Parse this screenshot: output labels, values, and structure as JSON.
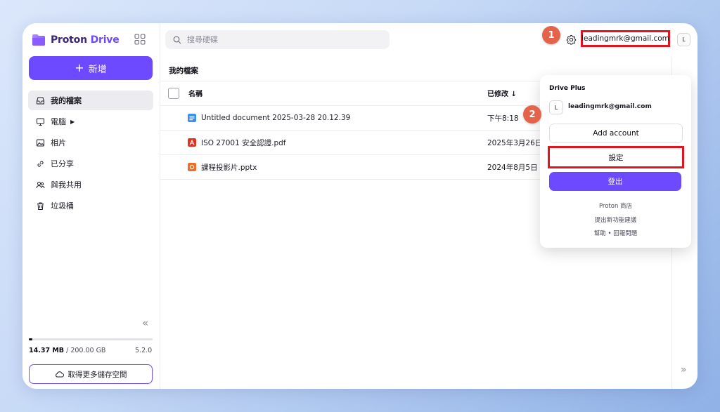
{
  "app": {
    "brand_first": "Proton",
    "brand_second": "Drive"
  },
  "sidebar": {
    "new_label": "新增",
    "items": [
      {
        "label": "我的檔案",
        "icon": "inbox-icon",
        "active": true
      },
      {
        "label": "電腦",
        "icon": "monitor-icon"
      },
      {
        "label": "相片",
        "icon": "photo-icon"
      },
      {
        "label": "已分享",
        "icon": "link-icon"
      },
      {
        "label": "與我共用",
        "icon": "users-icon"
      },
      {
        "label": "垃圾桶",
        "icon": "trash-icon"
      }
    ],
    "storage_used": "14.37 MB",
    "storage_total": "/ 200.00 GB",
    "storage_fraction": 0.03,
    "version": "5.2.0",
    "more_storage_label": "取得更多儲存空間"
  },
  "search": {
    "placeholder": "搜尋硬碟"
  },
  "account": {
    "email": "leadingmrk@gmail.com",
    "initial": "L"
  },
  "main": {
    "breadcrumb": "我的檔案",
    "columns": {
      "name": "名稱",
      "modified": "已修改 ↓"
    },
    "files": [
      {
        "name": "Untitled document 2025-03-28 20.12.39",
        "modified": "下午8:18",
        "type": "doc-icon"
      },
      {
        "name": "ISO 27001 安全認證.pdf",
        "modified": "2025年3月26日",
        "type": "pdf-icon"
      },
      {
        "name": "課程投影片.pptx",
        "modified": "2024年8月5日",
        "type": "pptx-icon"
      }
    ]
  },
  "popup": {
    "plan": "Drive Plus",
    "initial": "L",
    "email": "leadingmrk@gmail.com",
    "add_account": "Add account",
    "settings": "設定",
    "logout": "登出",
    "link1": "Proton 商店",
    "link2": "提出新功能建議",
    "link3": "幫助 • 回報問題"
  },
  "markers": {
    "m1": "1",
    "m2": "2"
  },
  "colors": {
    "accent": "#6d4aff",
    "highlight": "#e0151d",
    "marker": "#e3644b"
  }
}
